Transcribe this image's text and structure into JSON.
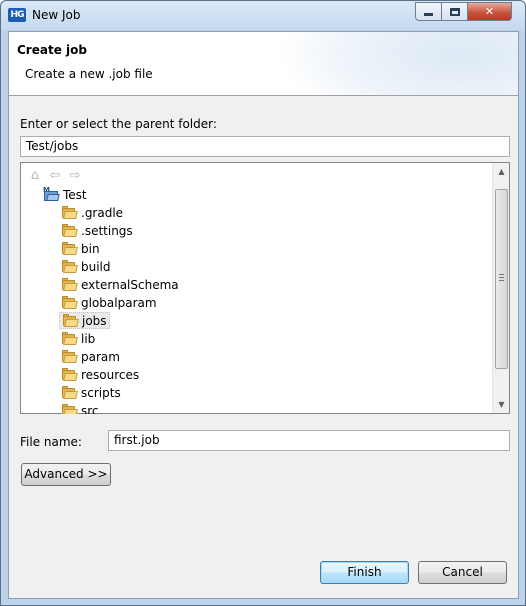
{
  "window": {
    "title": "New Job",
    "app_icon_text": "HG",
    "controls": [
      "minimize",
      "maximize",
      "close"
    ]
  },
  "header": {
    "title": "Create job",
    "subtitle": "Create a new .job file"
  },
  "parent_folder": {
    "label": "Enter or select the parent folder:",
    "value": "Test/jobs"
  },
  "tree": {
    "toolbar_icons": [
      "home-icon",
      "back-arrow-icon",
      "forward-arrow-icon"
    ],
    "project": "Test",
    "folders": [
      ".gradle",
      ".settings",
      "bin",
      "build",
      "externalSchema",
      "globalparam",
      "jobs",
      "lib",
      "param",
      "resources",
      "scripts",
      "src"
    ],
    "selected": "jobs"
  },
  "file_name": {
    "label": "File name:",
    "value": "first.job"
  },
  "buttons": {
    "advanced": "Advanced >>",
    "finish": "Finish",
    "cancel": "Cancel"
  }
}
